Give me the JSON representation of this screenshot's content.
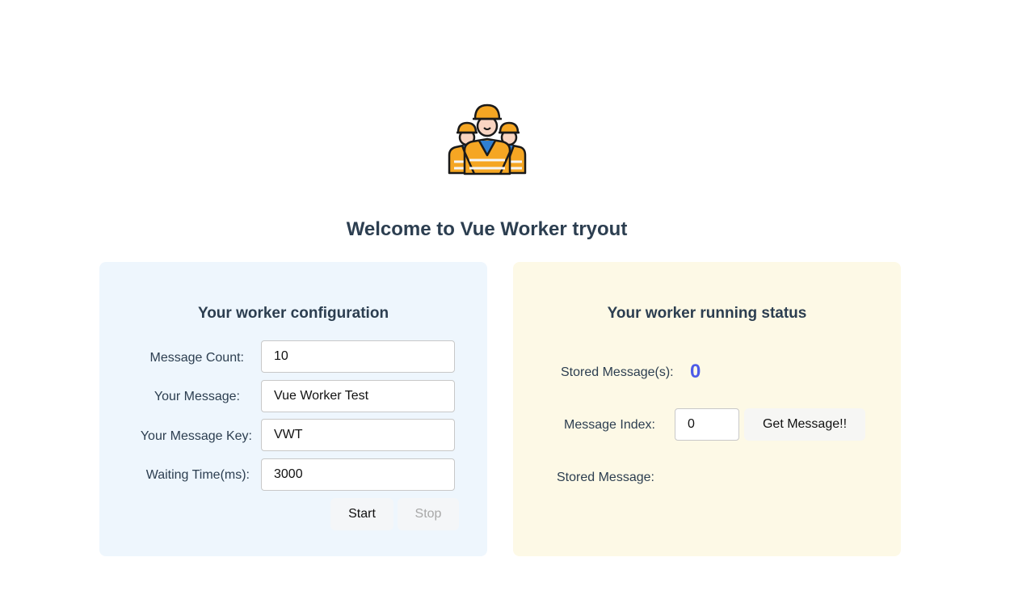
{
  "header": {
    "logo_icon": "construction-workers-icon",
    "title": "Welcome to Vue Worker tryout"
  },
  "config": {
    "heading": "Your worker configuration",
    "message_count_label": "Message Count:",
    "message_count_value": "10",
    "message_label": "Your Message:",
    "message_value": "Vue Worker Test",
    "key_label": "Your Message Key:",
    "key_value": "VWT",
    "wait_label": "Waiting Time(ms):",
    "wait_value": "3000",
    "start_label": "Start",
    "stop_label": "Stop",
    "background": "#eef6fd"
  },
  "status": {
    "heading": "Your worker running status",
    "stored_label": "Stored Message(s):",
    "stored_count": "0",
    "index_label": "Message Index:",
    "index_value": "0",
    "get_label": "Get Message!!",
    "stored_message_label": "Stored Message:",
    "stored_message_value": "",
    "background": "#fdf9e6",
    "count_color": "#4d5be8"
  }
}
